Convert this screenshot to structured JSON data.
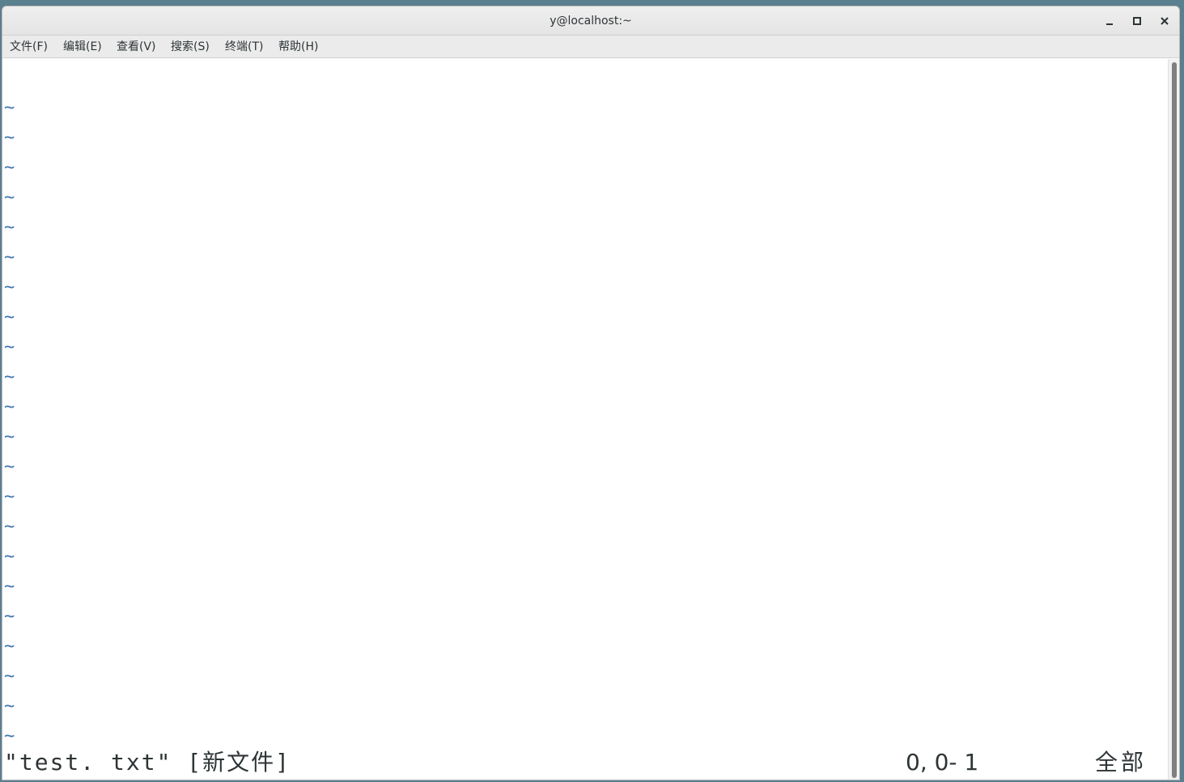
{
  "window": {
    "title": "y@localhost:~"
  },
  "menu": [
    {
      "label": "文件(F)"
    },
    {
      "label": "编辑(E)"
    },
    {
      "label": "查看(V)"
    },
    {
      "label": "搜索(S)"
    },
    {
      "label": "终端(T)"
    },
    {
      "label": "帮助(H)"
    }
  ],
  "editor": {
    "empty_line_marker": "~",
    "empty_line_count": 22
  },
  "status": {
    "file_message": "\"test. txt\" [新文件]",
    "cursor_position": "0, 0- 1",
    "scroll_position": "全部"
  },
  "colors": {
    "tilde": "#3f76b0",
    "background": "#ffffff",
    "text": "#2e3436"
  }
}
